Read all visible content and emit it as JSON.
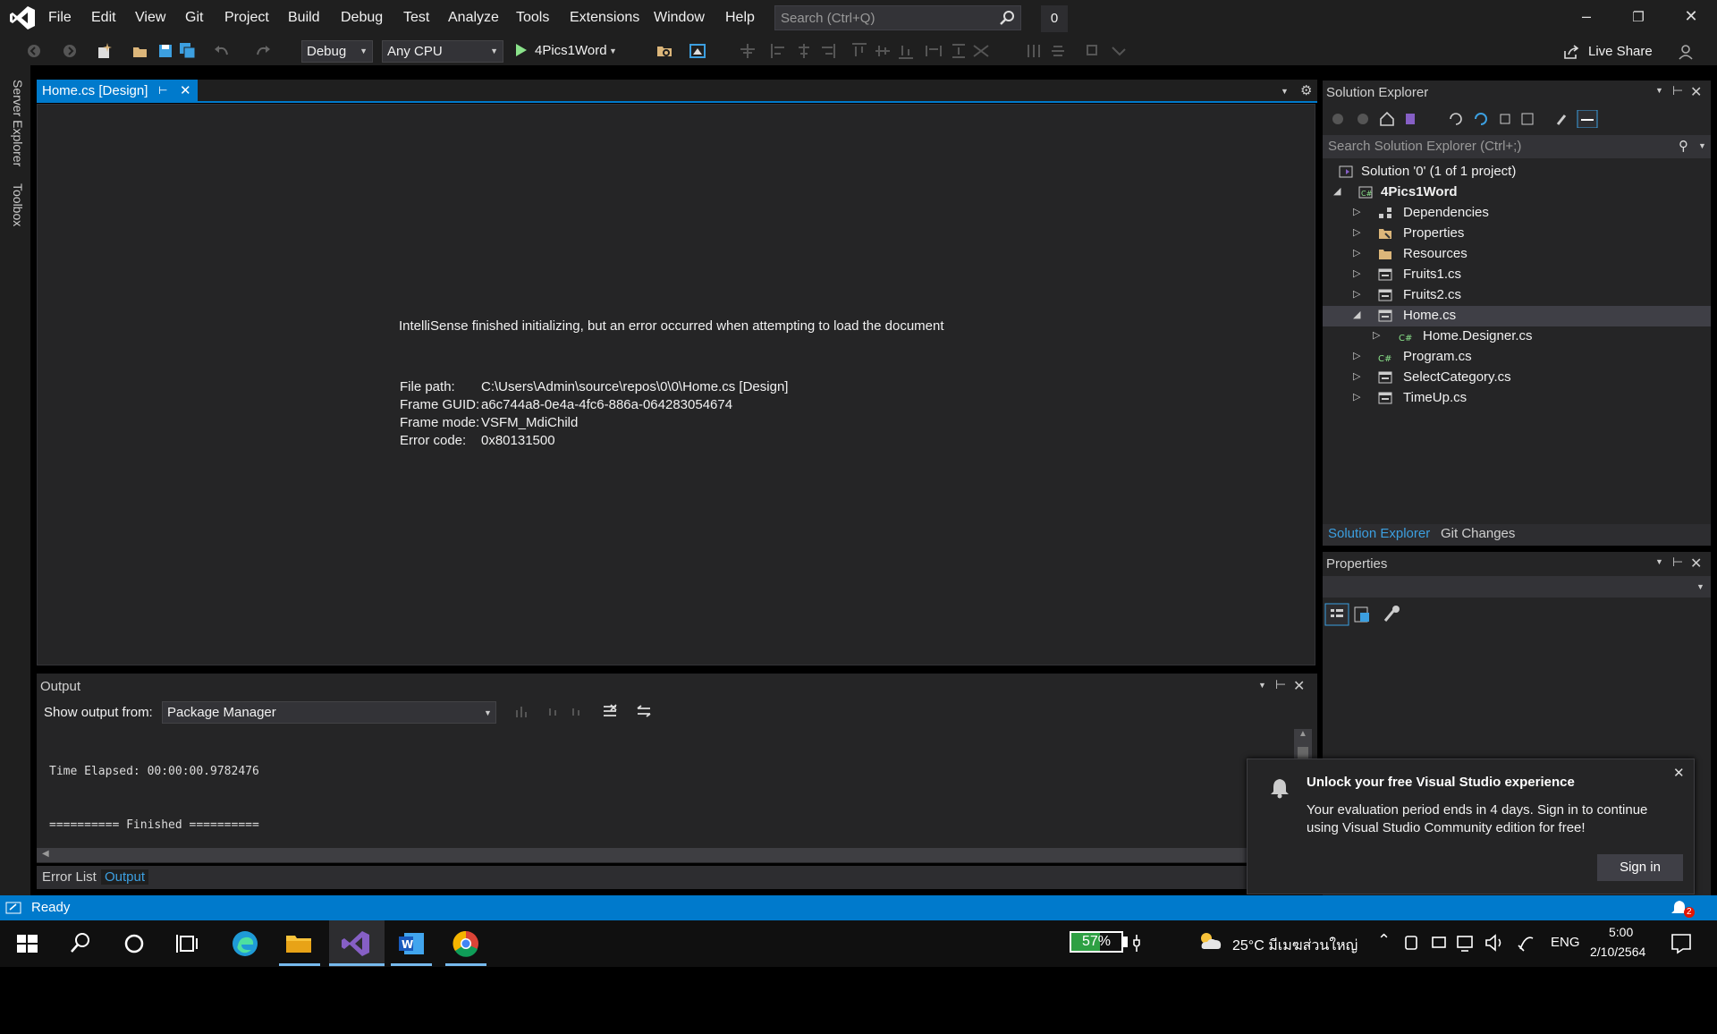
{
  "menu": [
    "File",
    "Edit",
    "View",
    "Git",
    "Project",
    "Build",
    "Debug",
    "Test",
    "Analyze",
    "Tools",
    "Extensions",
    "Window",
    "Help"
  ],
  "search": {
    "placeholder": "Search (Ctrl+Q)"
  },
  "notifications_count": "0",
  "toolbar": {
    "config": "Debug",
    "platform": "Any CPU",
    "run_target": "4Pics1Word",
    "live_share": "Live Share"
  },
  "left_rail": {
    "server_explorer": "Server Explorer",
    "toolbox": "Toolbox"
  },
  "document": {
    "tab_label": "Home.cs [Design]",
    "message": "IntelliSense finished initializing, but an error occurred when attempting to load the document",
    "details": [
      {
        "key": "File path:",
        "value": "C:\\Users\\Admin\\source\\repos\\0\\0\\Home.cs [Design]"
      },
      {
        "key": "Frame GUID:",
        "value": "a6c744a8-0e4a-4fc6-886a-064283054674"
      },
      {
        "key": "Frame mode:",
        "value": "VSFM_MdiChild"
      },
      {
        "key": "Error code:",
        "value": "0x80131500"
      }
    ]
  },
  "solution_explorer": {
    "title": "Solution Explorer",
    "search_placeholder": "Search Solution Explorer (Ctrl+;)",
    "items": [
      {
        "label": "Solution '0' (1 of 1 project)",
        "icon": "solution-icon"
      },
      {
        "label": "4Pics1Word",
        "icon": "csharp-project-icon"
      },
      {
        "label": "Dependencies",
        "icon": "dependencies-icon"
      },
      {
        "label": "Properties",
        "icon": "properties-folder-icon"
      },
      {
        "label": "Resources",
        "icon": "folder-icon"
      },
      {
        "label": "Fruits1.cs",
        "icon": "form-icon"
      },
      {
        "label": "Fruits2.cs",
        "icon": "form-icon"
      },
      {
        "label": "Home.cs",
        "icon": "form-icon"
      },
      {
        "label": "Home.Designer.cs",
        "icon": "csharp-file-icon"
      },
      {
        "label": "Program.cs",
        "icon": "csharp-file-icon"
      },
      {
        "label": "SelectCategory.cs",
        "icon": "form-icon"
      },
      {
        "label": "TimeUp.cs",
        "icon": "form-icon"
      }
    ],
    "tabs": [
      "Solution Explorer",
      "Git Changes"
    ]
  },
  "properties": {
    "title": "Properties"
  },
  "output": {
    "title": "Output",
    "show_from_label": "Show output from:",
    "source": "Package Manager",
    "lines": [
      "Time Elapsed: 00:00:00.9782476",
      "========== Finished =========="
    ]
  },
  "bottom_tabs": [
    "Error List",
    "Output"
  ],
  "toast": {
    "title": "Unlock your free Visual Studio experience",
    "body": "Your evaluation period ends in 4 days. Sign in to continue using Visual Studio Community edition for free!",
    "button": "Sign in"
  },
  "status": {
    "text": "Ready",
    "badge": "2"
  },
  "taskbar": {
    "battery": "57%",
    "weather": "25°C  มีเมฆส่วนใหญ่",
    "lang": "ENG",
    "time": "5:00",
    "date": "2/10/2564"
  },
  "colors": {
    "accent": "#007acc",
    "vs_purple": "#865fc5",
    "background": "#1f1f1f"
  }
}
